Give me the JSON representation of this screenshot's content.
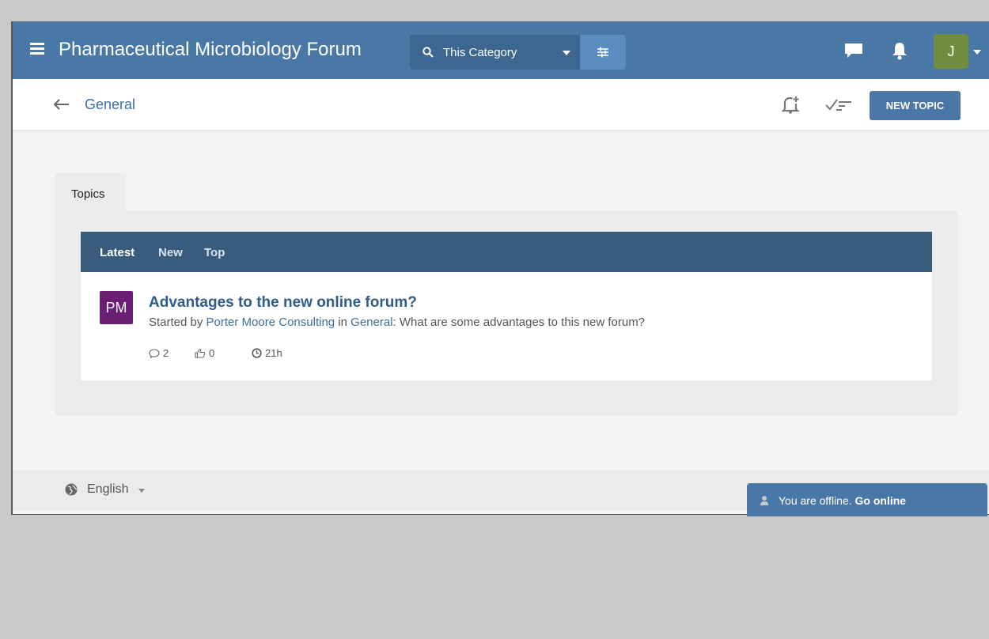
{
  "header": {
    "forum_title": "Pharmaceutical Microbiology Forum",
    "search_scope": "This Category",
    "user_initial": "J",
    "user_color": "#6f8f3e",
    "brand_color": "#4a78a6"
  },
  "subheader": {
    "breadcrumb": "General",
    "new_topic_label": "NEW TOPIC"
  },
  "tabs": {
    "topics": "Topics"
  },
  "list_nav": {
    "latest": "Latest",
    "new": "New",
    "top": "Top"
  },
  "topics": [
    {
      "avatar_initials": "PM",
      "avatar_color": "#6a1f74",
      "title": "Advantages to the new online forum?",
      "started_by_prefix": "Started by",
      "author": "Porter Moore Consulting",
      "in_prefix": "in",
      "category": "General",
      "excerpt": ": What are some advantages to this new forum?",
      "replies": "2",
      "likes": "0",
      "age": "21h"
    }
  ],
  "footer": {
    "language": "English"
  },
  "offline": {
    "message": "You are offline.",
    "action": "Go online"
  }
}
